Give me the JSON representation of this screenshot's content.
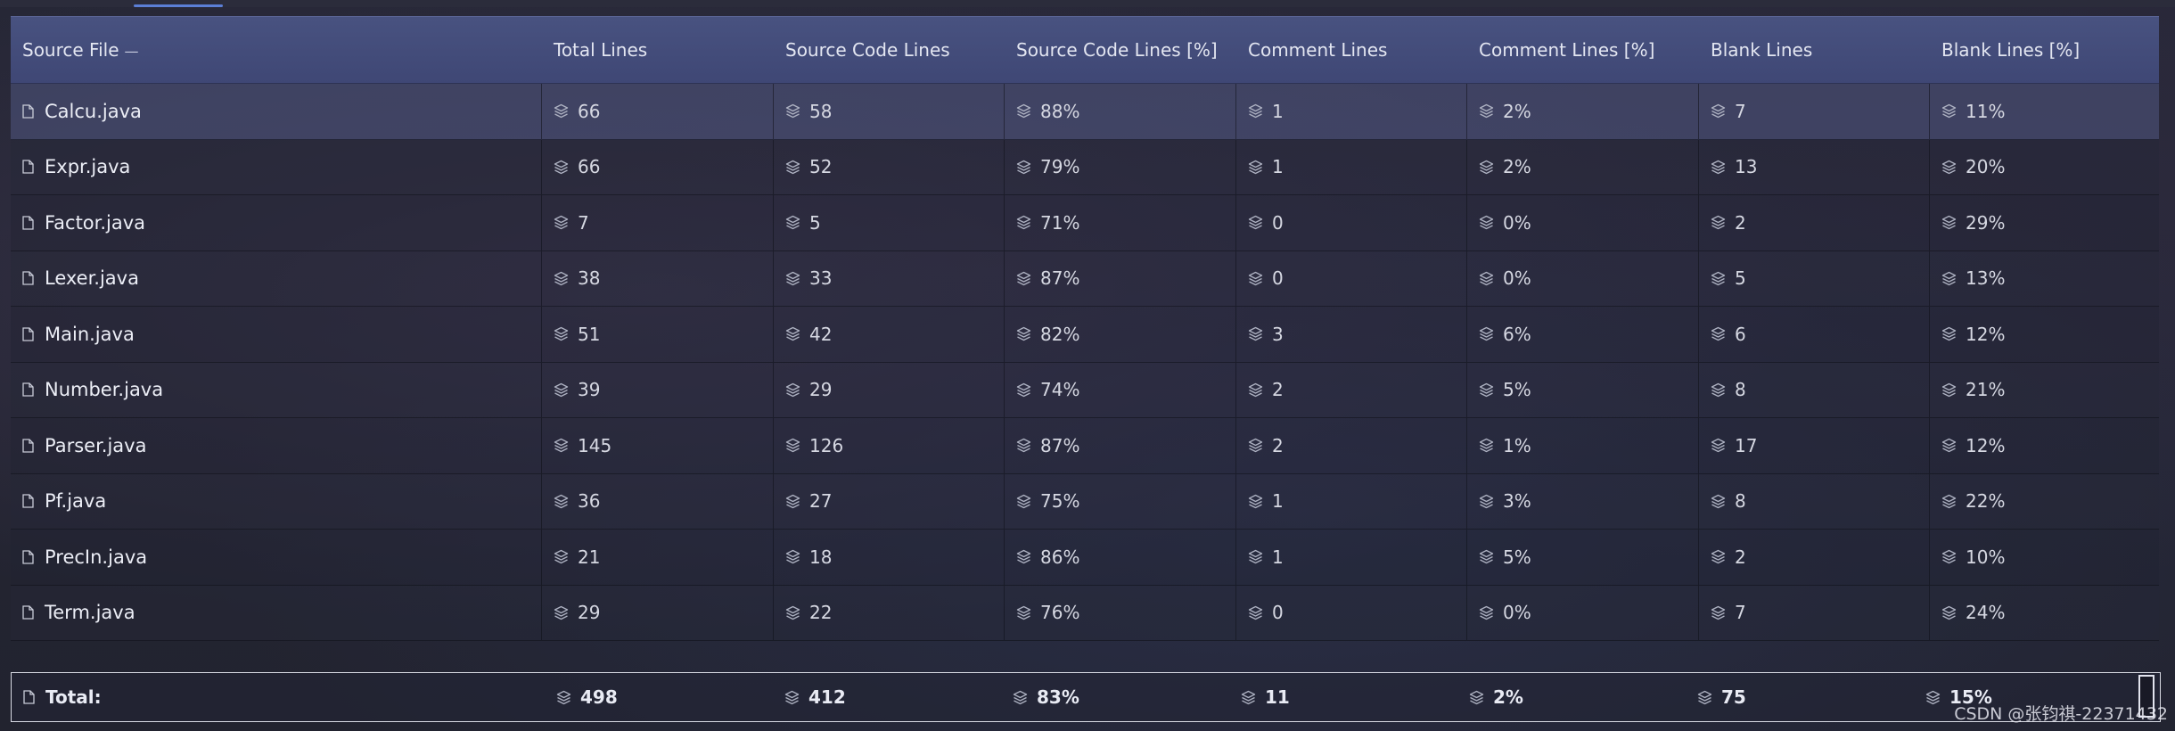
{
  "header": {
    "columns": [
      "Source File",
      "Total Lines",
      "Source Code Lines",
      "Source Code Lines [%]",
      "Comment Lines",
      "Comment Lines [%]",
      "Blank Lines",
      "Blank Lines [%]"
    ],
    "sort_indicator": "—"
  },
  "rows": [
    {
      "file": "Calcu.java",
      "total": "66",
      "code": "58",
      "code_pct": "88%",
      "comment": "1",
      "comment_pct": "2%",
      "blank": "7",
      "blank_pct": "11%"
    },
    {
      "file": "Expr.java",
      "total": "66",
      "code": "52",
      "code_pct": "79%",
      "comment": "1",
      "comment_pct": "2%",
      "blank": "13",
      "blank_pct": "20%"
    },
    {
      "file": "Factor.java",
      "total": "7",
      "code": "5",
      "code_pct": "71%",
      "comment": "0",
      "comment_pct": "0%",
      "blank": "2",
      "blank_pct": "29%"
    },
    {
      "file": "Lexer.java",
      "total": "38",
      "code": "33",
      "code_pct": "87%",
      "comment": "0",
      "comment_pct": "0%",
      "blank": "5",
      "blank_pct": "13%"
    },
    {
      "file": "Main.java",
      "total": "51",
      "code": "42",
      "code_pct": "82%",
      "comment": "3",
      "comment_pct": "6%",
      "blank": "6",
      "blank_pct": "12%"
    },
    {
      "file": "Number.java",
      "total": "39",
      "code": "29",
      "code_pct": "74%",
      "comment": "2",
      "comment_pct": "5%",
      "blank": "8",
      "blank_pct": "21%"
    },
    {
      "file": "Parser.java",
      "total": "145",
      "code": "126",
      "code_pct": "87%",
      "comment": "2",
      "comment_pct": "1%",
      "blank": "17",
      "blank_pct": "12%"
    },
    {
      "file": "Pf.java",
      "total": "36",
      "code": "27",
      "code_pct": "75%",
      "comment": "1",
      "comment_pct": "3%",
      "blank": "8",
      "blank_pct": "22%"
    },
    {
      "file": "PrecIn.java",
      "total": "21",
      "code": "18",
      "code_pct": "86%",
      "comment": "1",
      "comment_pct": "5%",
      "blank": "2",
      "blank_pct": "10%"
    },
    {
      "file": "Term.java",
      "total": "29",
      "code": "22",
      "code_pct": "76%",
      "comment": "0",
      "comment_pct": "0%",
      "blank": "7",
      "blank_pct": "24%"
    }
  ],
  "total": {
    "label": "Total:",
    "total": "498",
    "code": "412",
    "code_pct": "83%",
    "comment": "11",
    "comment_pct": "2%",
    "blank": "75",
    "blank_pct": "15%"
  },
  "watermark": "CSDN @张钧祺-22371432",
  "colors": {
    "header_bg": "#485280",
    "selected_row_bg": "#50587f",
    "accent": "#5b7fd6"
  }
}
